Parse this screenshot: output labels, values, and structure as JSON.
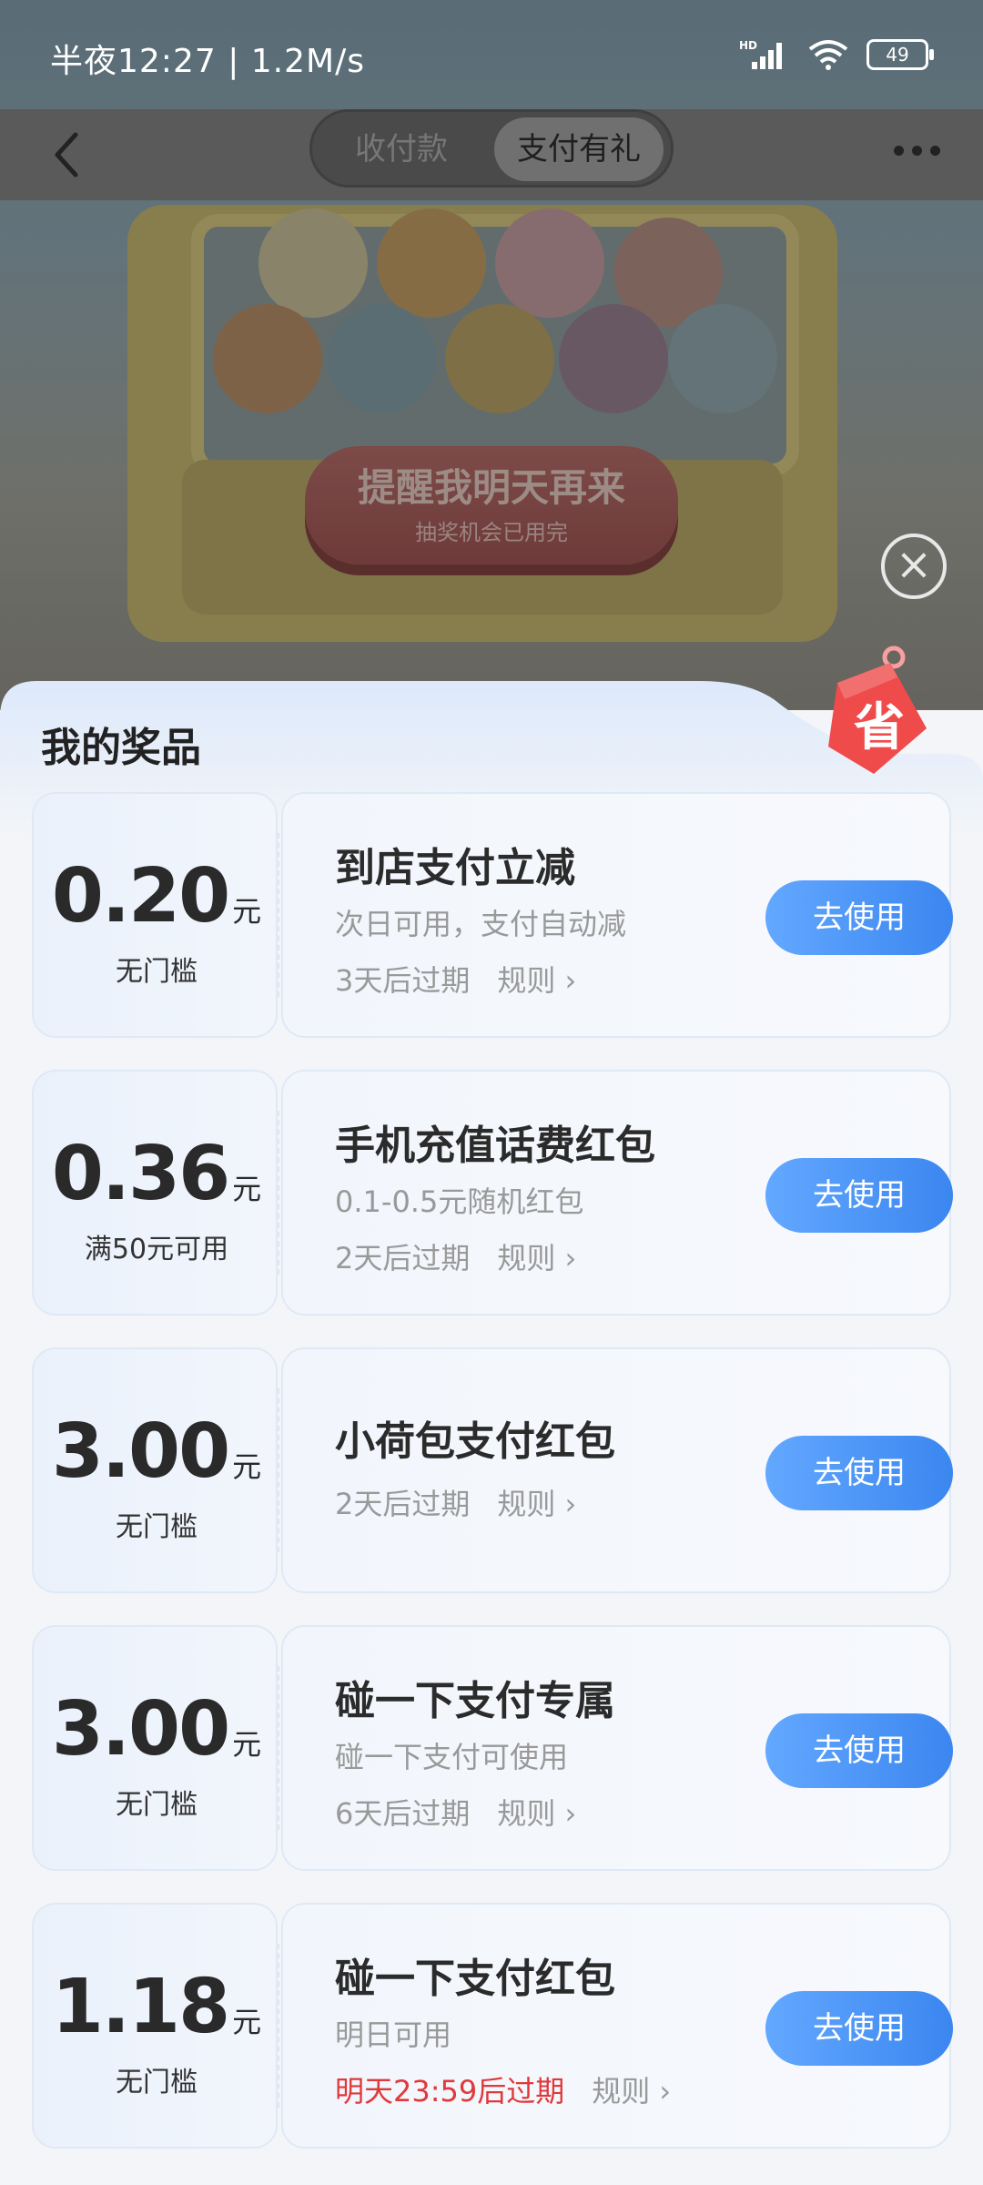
{
  "status_bar": {
    "time": "半夜12:27 | 1.2M/s",
    "battery": "49",
    "icons": [
      "hd-signal-icon",
      "wifi-icon",
      "battery-icon"
    ]
  },
  "nav": {
    "tabs": [
      {
        "label": "收付款",
        "active": false
      },
      {
        "label": "支付有礼",
        "active": true
      }
    ]
  },
  "banner": {
    "button_title": "提醒我明天再来",
    "button_subtitle": "抽奖机会已用完"
  },
  "sheet": {
    "title": "我的奖品",
    "badge_text": "省"
  },
  "prizes": [
    {
      "amount": "0.20",
      "unit": "元",
      "condition": "无门槛",
      "title": "到店支付立减",
      "desc": "次日可用，支付自动减",
      "expiry": "3天后过期",
      "rule": "规则 ›",
      "button": "去使用"
    },
    {
      "amount": "0.36",
      "unit": "元",
      "condition": "满50元可用",
      "title": "手机充值话费红包",
      "desc": "0.1-0.5元随机红包",
      "expiry": "2天后过期",
      "rule": "规则 ›",
      "button": "去使用"
    },
    {
      "amount": "3.00",
      "unit": "元",
      "condition": "无门槛",
      "title": "小荷包支付红包",
      "desc": "",
      "expiry": "2天后过期",
      "rule": "规则 ›",
      "button": "去使用"
    },
    {
      "amount": "3.00",
      "unit": "元",
      "condition": "无门槛",
      "title": "碰一下支付专属",
      "desc": "碰一下支付可使用",
      "expiry": "6天后过期",
      "rule": "规则 ›",
      "button": "去使用"
    },
    {
      "amount": "1.18",
      "unit": "元",
      "condition": "无门槛",
      "title": "碰一下支付红包",
      "desc": "明日可用",
      "expiry": "明天23:59后过期",
      "rule": "规则 ›",
      "button": "去使用"
    }
  ],
  "colors": {
    "accent_button": "#3b86f0",
    "expiry_urgent": "#e0383b"
  }
}
